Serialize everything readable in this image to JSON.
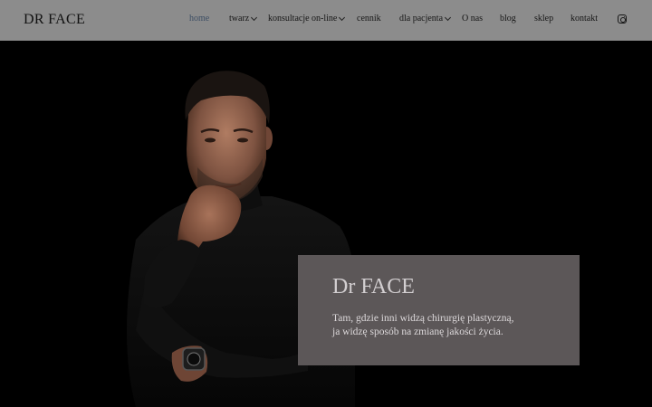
{
  "header": {
    "logo": "DR FACE",
    "nav": [
      {
        "label": "home",
        "active": true,
        "has_dropdown": false
      },
      {
        "label": "twarz",
        "active": false,
        "has_dropdown": true
      },
      {
        "label": "konsultacje on-line",
        "active": false,
        "has_dropdown": true
      },
      {
        "label": "cennik",
        "active": false,
        "has_dropdown": false
      },
      {
        "label": "dla pacjenta",
        "active": false,
        "has_dropdown": true
      },
      {
        "label": "O nas",
        "active": false,
        "has_dropdown": false
      },
      {
        "label": "blog",
        "active": false,
        "has_dropdown": false
      },
      {
        "label": "sklep",
        "active": false,
        "has_dropdown": false
      },
      {
        "label": "kontakt",
        "active": false,
        "has_dropdown": false
      }
    ],
    "social_icon": "instagram-icon"
  },
  "hero": {
    "image": "portrait-photo",
    "card": {
      "title": "Dr FACE",
      "line1": "Tam, gdzie inni widzą chirurgię plastyczną,",
      "line2": "ja widzę sposób na zmianę jakości życia."
    }
  },
  "colors": {
    "header_bg": "#8c8c8c",
    "active_nav": "#3d4e64",
    "card_bg": "#5c5758",
    "hero_bg": "#000000"
  }
}
